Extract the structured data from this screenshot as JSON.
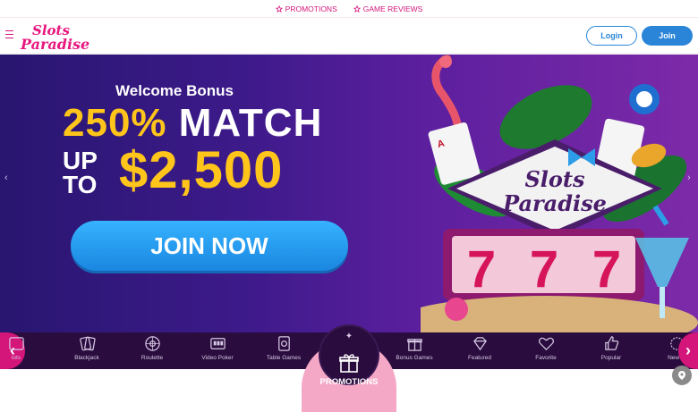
{
  "topstrip": {
    "promotions": "PROMOTIONS",
    "game_reviews": "GAME REVIEWS"
  },
  "header": {
    "logo_line1": "Slots",
    "logo_line2": "Paradise",
    "login": "Login",
    "join": "Join"
  },
  "hero": {
    "welcome": "Welcome Bonus",
    "pct": "250%",
    "match": " MATCH",
    "up": "UP",
    "to": "TO",
    "amount": "$2,500",
    "cta": "JOIN NOW",
    "art_logo1": "Slots",
    "art_logo2": "Paradise",
    "reel_symbol": "7"
  },
  "categories": [
    {
      "label": "lots",
      "icon": "slots-icon"
    },
    {
      "label": "Blackjack",
      "icon": "blackjack-icon"
    },
    {
      "label": "Roulette",
      "icon": "roulette-icon"
    },
    {
      "label": "Video Poker",
      "icon": "video-poker-icon"
    },
    {
      "label": "Table Games",
      "icon": "table-games-icon"
    },
    {
      "label": "Bonus Games",
      "icon": "bonus-games-icon"
    },
    {
      "label": "Featured",
      "icon": "featured-icon"
    },
    {
      "label": "Favorite",
      "icon": "favorite-icon"
    },
    {
      "label": "Popular",
      "icon": "popular-icon"
    },
    {
      "label": "New G",
      "icon": "new-games-icon"
    }
  ],
  "promo_tab": {
    "label": "PROMOTIONS"
  },
  "colors": {
    "brand": "#d4157a",
    "accent_blue": "#2a85d8",
    "gold": "#ffc51a",
    "catbar": "#2a0d3e"
  }
}
